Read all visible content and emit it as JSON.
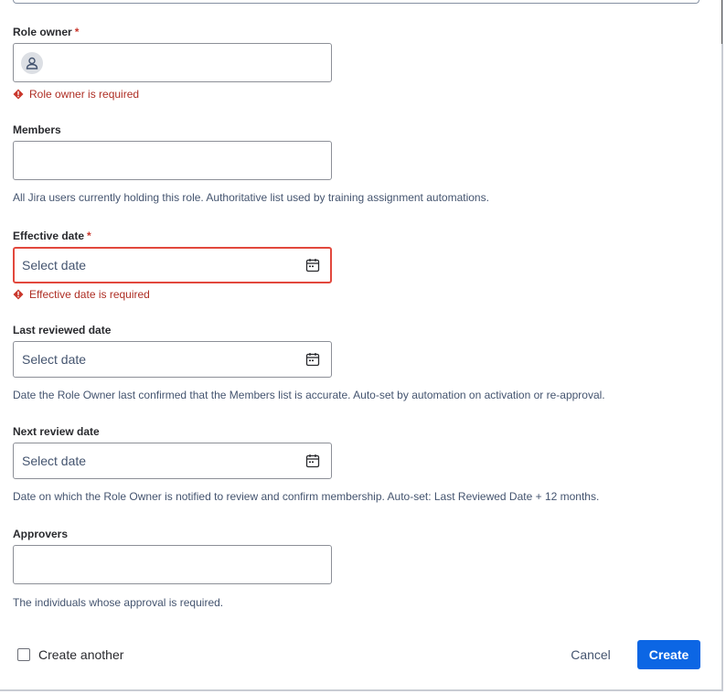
{
  "form": {
    "role_owner": {
      "label": "Role owner",
      "required_marker": "*",
      "error": "Role owner is required"
    },
    "members": {
      "label": "Members",
      "help": "All Jira users currently holding this role. Authoritative list used by training assignment automations."
    },
    "effective_date": {
      "label": "Effective date",
      "required_marker": "*",
      "placeholder": "Select date",
      "error": "Effective date is required"
    },
    "last_reviewed_date": {
      "label": "Last reviewed date",
      "placeholder": "Select date",
      "help": "Date the Role Owner last confirmed that the Members list is accurate. Auto-set by automation on activation or re-approval."
    },
    "next_review_date": {
      "label": "Next review date",
      "placeholder": "Select date",
      "help": "Date on which the Role Owner is notified to review and confirm membership. Auto-set: Last Reviewed Date + 12 months."
    },
    "approvers": {
      "label": "Approvers",
      "help": "The individuals whose approval is required."
    }
  },
  "footer": {
    "create_another_label": "Create another",
    "cancel_label": "Cancel",
    "create_label": "Create"
  },
  "colors": {
    "error": "#ae2e24",
    "primary": "#0c66e4",
    "invalid_border": "#e2483d"
  }
}
